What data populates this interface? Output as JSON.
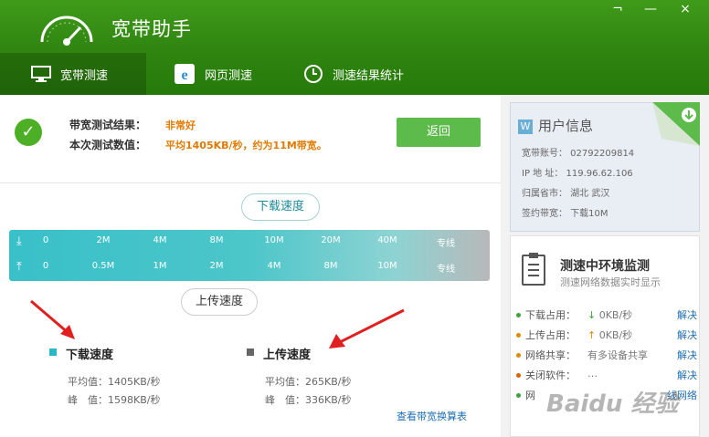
{
  "titlebar": {
    "title": "宽带助手",
    "minimize": "—",
    "restore": "¬",
    "close": "×"
  },
  "tabs": [
    {
      "label": "宽带测速",
      "icon": "monitor-icon",
      "active": true
    },
    {
      "label": "网页测速",
      "icon": "ie-icon",
      "active": false
    },
    {
      "label": "测速结果统计",
      "icon": "clock-icon",
      "active": false
    }
  ],
  "result": {
    "label1": "带宽测试结果：",
    "value1": "非常好",
    "label2": "本次测试数值：",
    "value2": "平均1405KB/秒，约为11M带宽。",
    "return_button": "返回"
  },
  "scale": {
    "download_label": "下载速度",
    "upload_label": "上传速度",
    "download_ticks": [
      "0",
      "2M",
      "4M",
      "8M",
      "10M",
      "20M",
      "40M",
      "专线"
    ],
    "upload_ticks": [
      "0",
      "0.5M",
      "1M",
      "2M",
      "4M",
      "8M",
      "10M",
      "专线"
    ]
  },
  "download_stats": {
    "title": "下载速度",
    "avg": "平均值：1405KB/秒",
    "peak": "峰　值：1598KB/秒",
    "color": "#2ab7c5"
  },
  "upload_stats": {
    "title": "上传速度",
    "avg": "平均值：265KB/秒",
    "peak": "峰　值：336KB/秒",
    "color": "#666666"
  },
  "calc_link": "查看带宽换算表",
  "user_info": {
    "title": "用户信息",
    "account": "宽带账号：  02792209814",
    "ip": "IP 地 址：  119.96.62.106",
    "region": "归属省市：  湖北 武汉",
    "bandwidth": "签约带宽：  下载10M"
  },
  "env": {
    "title": "测速中环境监测",
    "subtitle": "测速网络数据实时显示",
    "rows": [
      {
        "label": "下载占用：",
        "value": "0KB/秒",
        "action": "解决",
        "color": "#3aa23a",
        "arrow": "↓",
        "arrow_color": "#3aa23a"
      },
      {
        "label": "上传占用：",
        "value": "0KB/秒",
        "action": "解决",
        "color": "#e08a00",
        "arrow": "↑",
        "arrow_color": "#e08a00"
      },
      {
        "label": "网络共享：",
        "value": "有多设备共享",
        "action": "解决",
        "color": "#e08a00",
        "arrow": "",
        "arrow_color": ""
      },
      {
        "label": "关闭软件：",
        "value": "…",
        "action": "解决",
        "color": "#e06000",
        "arrow": "",
        "arrow_color": ""
      },
      {
        "label": "网",
        "value": "",
        "action": "线网络",
        "color": "#3aa23a",
        "arrow": "",
        "arrow_color": ""
      }
    ]
  },
  "watermark": "Baidu 经验"
}
